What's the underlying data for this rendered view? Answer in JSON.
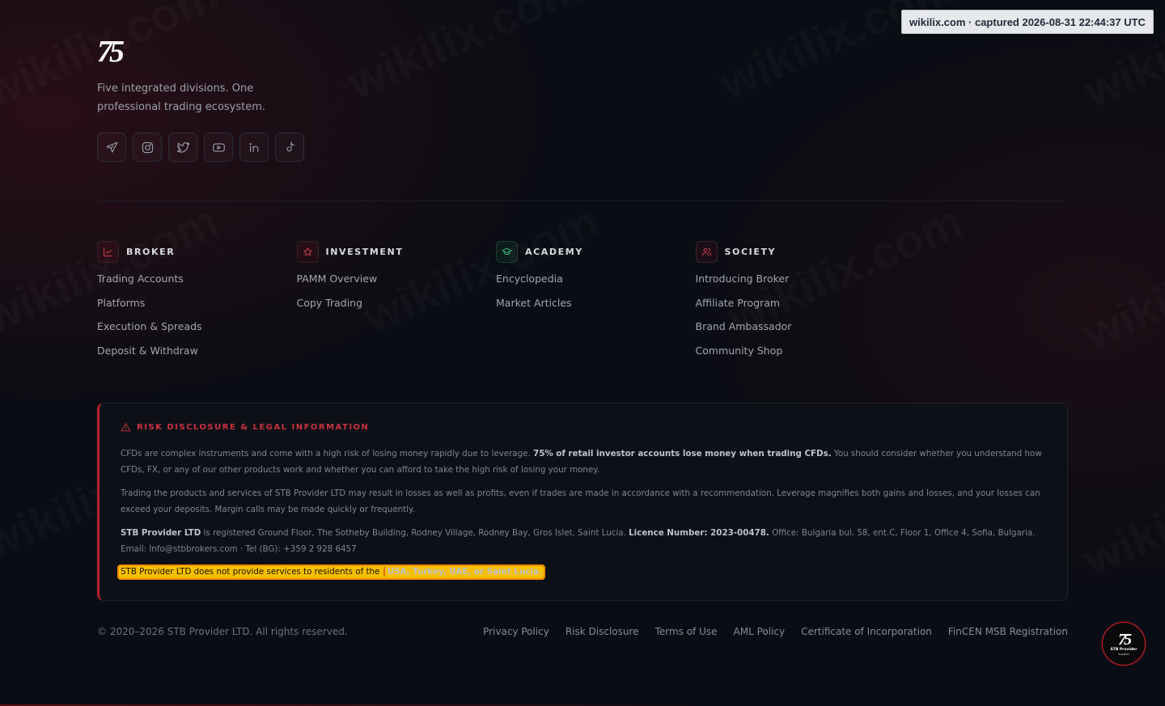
{
  "capture_badge": "wikilix.com · captured 2026-08-31 22:44:37 UTC",
  "watermark_text": "wikilix.com",
  "brand": {
    "logo_mark": "75",
    "tagline": "Five integrated divisions. One professional trading ecosystem."
  },
  "socials": [
    {
      "icon": "telegram-icon"
    },
    {
      "icon": "instagram-icon"
    },
    {
      "icon": "twitter-icon"
    },
    {
      "icon": "youtube-icon"
    },
    {
      "icon": "linkedin-icon"
    },
    {
      "icon": "tiktok-icon"
    }
  ],
  "columns": [
    {
      "title": "BROKER",
      "icon": "chart-icon",
      "links": [
        "Trading Accounts",
        "Platforms",
        "Execution & Spreads",
        "Deposit & Withdraw"
      ]
    },
    {
      "title": "INVESTMENT",
      "icon": "star-icon",
      "links": [
        "PAMM Overview",
        "Copy Trading"
      ]
    },
    {
      "title": "ACADEMY",
      "icon": "graduation-cap-icon",
      "links": [
        "Encyclopedia",
        "Market Articles"
      ]
    },
    {
      "title": "SOCIETY",
      "icon": "users-icon",
      "links": [
        "Introducing Broker",
        "Affiliate Program",
        "Brand Ambassador",
        "Community Shop"
      ]
    }
  ],
  "risk": {
    "title": "RISK DISCLOSURE & LEGAL INFORMATION",
    "p1_a": "CFDs are complex instruments and come with a high risk of losing money rapidly due to leverage. ",
    "p1_b": "75% of retail investor accounts lose money when trading CFDs.",
    "p1_c": " You should consider whether you understand how CFDs, FX, or any of our other products work and whether you can afford to take the high risk of losing your money.",
    "p2": "Trading the products and services of STB Provider LTD may result in losses as well as profits, even if trades are made in accordance with a recommendation. Leverage magnifies both gains and losses, and your losses can exceed your deposits. Margin calls may be made quickly or frequently.",
    "p3_a": "STB Provider LTD",
    "p3_b": " is registered Ground Floor, The Sotheby Building, Rodney Village, Rodney Bay, Gros Islet, Saint Lucia. ",
    "p3_c": "Licence Number: 2023-00478.",
    "p3_d": " Office: Bulgaria bul. 58, ent.C, Floor 1, Office 4, Sofia, Bulgaria. Email: Info@stbbrokers.com · Tel (BG): +359 2 928 6457",
    "restriction_a": "STB Provider LTD does not provide services to residents of the",
    "restriction_b": "USA, Turkey, UAE, or Saint Lucia."
  },
  "footer": {
    "copyright": "© 2020–2026 STB Provider LTD. All rights reserved.",
    "links": [
      "Privacy Policy",
      "Risk Disclosure",
      "Terms of Use",
      "AML Policy",
      "Certificate of Incorporation",
      "FinCEN MSB Registration"
    ]
  },
  "support_badge": {
    "logo": "75",
    "label": "STB Provider",
    "sub": "Support"
  },
  "colors": {
    "accent": "#c8323f",
    "background": "#0b0d14",
    "highlight": "#f6c000"
  }
}
